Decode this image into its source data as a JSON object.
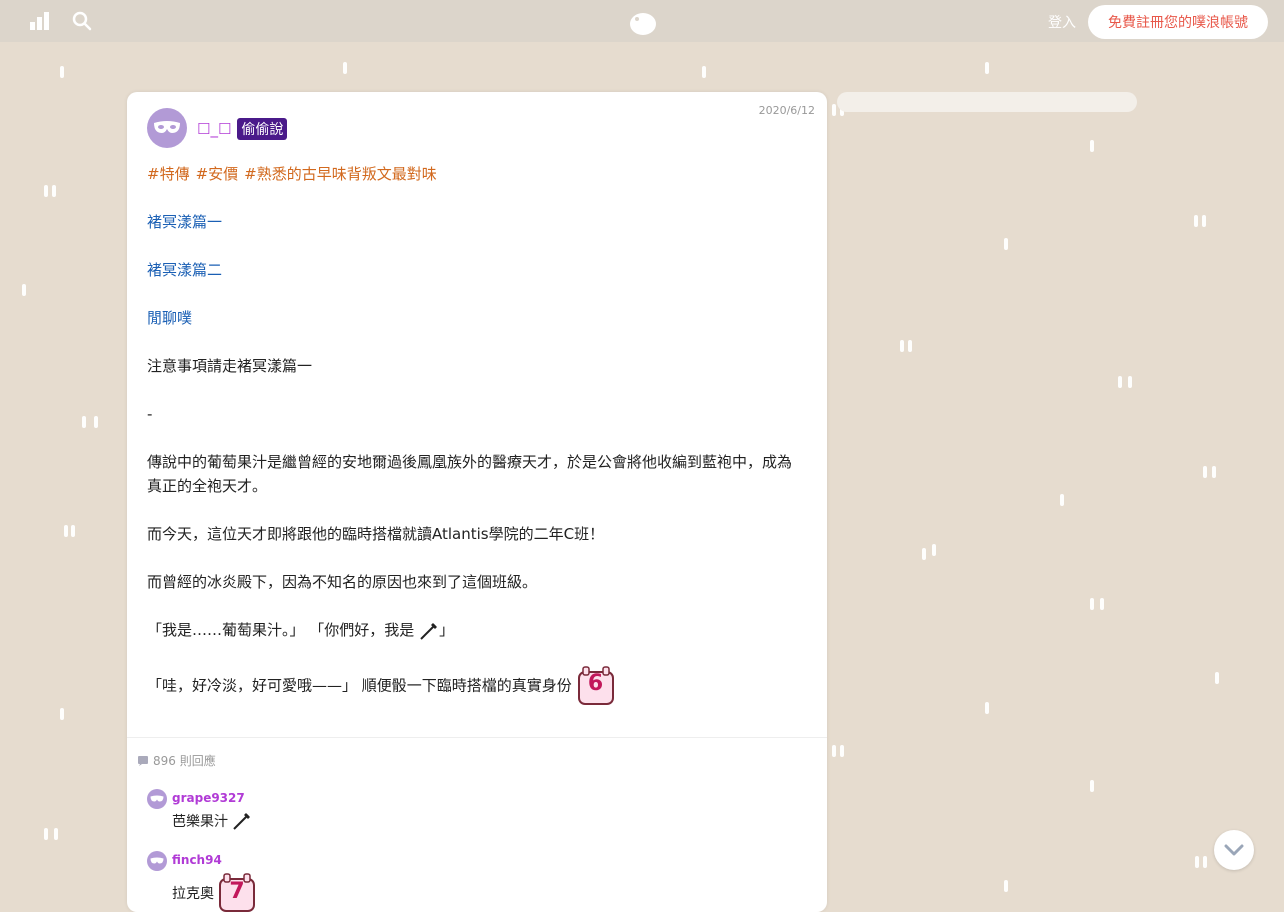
{
  "topbar": {
    "login": "登入",
    "signup": "免費註冊您的噗浪帳號",
    "icons": [
      "stats-icon",
      "search-icon",
      "plurk-logo-icon"
    ]
  },
  "post": {
    "author": "☐_☐",
    "badge": "偷偷說",
    "date": "2020/6/12",
    "tags": [
      "#特傳",
      "#安價",
      "#熟悉的古早味背叛文最對味"
    ],
    "links": [
      "褚冥漾篇一",
      "褚冥漾篇二",
      "閒聊噗"
    ],
    "lines": [
      "注意事項請走褚冥漾篇一",
      "-",
      "傳說中的葡萄果汁是繼曾經的安地爾過後鳳凰族外的醫療天才，於是公會將他收編到藍袍中，成為真正的全袍天才。",
      "而今天，這位天才即將跟他的臨時搭檔就讀Atlantis學院的二年C班！",
      "而曾經的冰炎殿下，因為不知名的原因也來到了這個班級。",
      "「我是……葡萄果汁。」 「你們好，我是",
      "」",
      "「哇，好冷淡，好可愛哦——」 順便骰一下臨時搭檔的真實身份"
    ],
    "dice1": "6",
    "responses": "896 則回應"
  },
  "replies": [
    {
      "user": "grape9327",
      "text": "芭樂果汁"
    },
    {
      "user": "finch94",
      "text": "拉克奧",
      "dice": "7"
    }
  ],
  "colors": {
    "accent": "#e8584a",
    "author": "#b13bd6",
    "link": "#1a5fb4",
    "tag": "#d2691e",
    "bg": "#e6dccf"
  }
}
